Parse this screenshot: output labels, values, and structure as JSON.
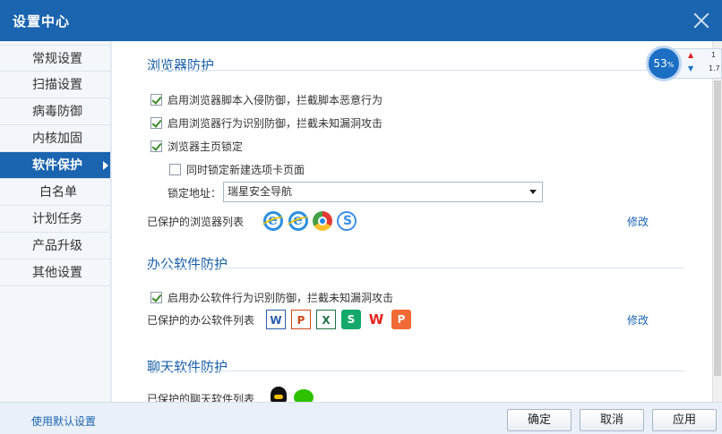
{
  "window": {
    "title": "设置中心"
  },
  "sidebar": {
    "items": [
      {
        "label": "常规设置"
      },
      {
        "label": "扫描设置"
      },
      {
        "label": "病毒防御"
      },
      {
        "label": "内核加固"
      },
      {
        "label": "软件保护"
      },
      {
        "label": "白名单"
      },
      {
        "label": "计划任务"
      },
      {
        "label": "产品升级"
      },
      {
        "label": "其他设置"
      }
    ],
    "active_index": 4
  },
  "browser": {
    "title": "浏览器防护",
    "options": [
      {
        "label": "启用浏览器脚本入侵防御，拦截脚本恶意行为",
        "checked": true
      },
      {
        "label": "启用浏览器行为识别防御，拦截未知漏洞攻击",
        "checked": true
      },
      {
        "label": "浏览器主页锁定",
        "checked": true
      },
      {
        "label": "同时锁定新建选项卡页面",
        "checked": false
      }
    ],
    "lock_label": "锁定地址：",
    "lock_value": "瑞星安全导航",
    "protected_label": "已保护的浏览器列表",
    "protected_icons": [
      "ie-icon",
      "ie-icon",
      "chrome-icon",
      "sogou-browser-icon"
    ],
    "modify": "修改"
  },
  "office": {
    "title": "办公软件防护",
    "options": [
      {
        "label": "启用办公软件行为识别防御，拦截未知漏洞攻击",
        "checked": true
      }
    ],
    "protected_label": "已保护的办公软件列表",
    "icons": [
      "W",
      "P",
      "X",
      "S",
      "W",
      "P"
    ],
    "modify": "修改"
  },
  "chat": {
    "title": "聊天软件防护",
    "protected_label": "已保护的聊天软件列表",
    "icons": [
      "qq-icon",
      "wechat-icon"
    ]
  },
  "footer": {
    "default_link": "使用默认设置",
    "ok": "确定",
    "cancel": "取消",
    "apply": "应用"
  },
  "monitor": {
    "percent": "53",
    "unit": "%",
    "up_value": "1",
    "down_value": "1.7"
  },
  "colors": {
    "titlebar": "#1a64b0",
    "active_item": "#1a64b0",
    "section_title": "#1a5fa8",
    "link": "#1a64b0"
  }
}
